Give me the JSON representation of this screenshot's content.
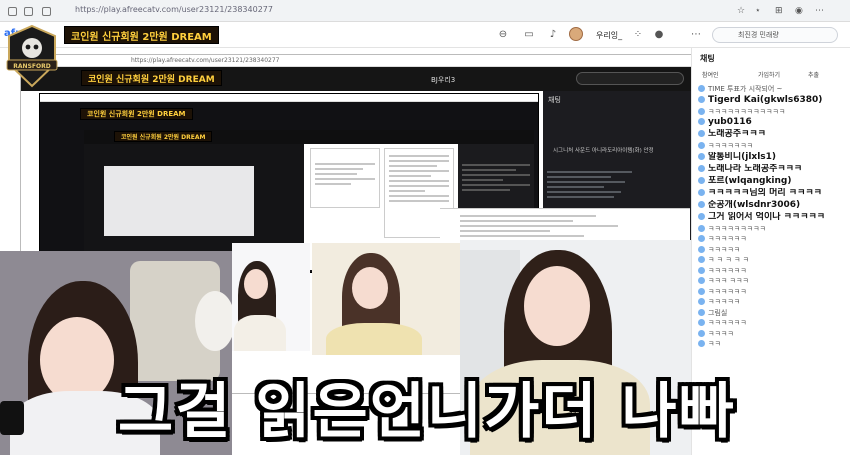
{
  "browser": {
    "url": "https://play.afreecatv.com/user23121/238340277",
    "inner_url": "https://play.afreecatv.com/user23121/238340277"
  },
  "app": {
    "logo": "afreeca",
    "banner_title": "코인원 신규회원 2만원 DREAM",
    "user_name": "우리잉_",
    "search_placeholder": "최진경 민래량",
    "nested_user_name": "BJ우리3"
  },
  "badge": {
    "text": "RANSFORD"
  },
  "inner_chat": {
    "title": "채팅",
    "notice": "시그니처 사운드 아니라도리아이템(화) 안정"
  },
  "chat": {
    "title": "채팅",
    "tabs": [
      "참여인",
      "가입하기",
      "추출"
    ],
    "messages": [
      {
        "name": "",
        "text": "TIME 투표가 시작되어 ~",
        "big": false
      },
      {
        "name": "",
        "text": "Tigerd Kai(gkwls6380)",
        "big": true
      },
      {
        "name": "",
        "text": "ㅋㅋㅋㅋㅋㅋㅋㅋㅋㅋㅋㅋ",
        "big": false
      },
      {
        "name": "",
        "text": "yub0116",
        "big": true
      },
      {
        "name": "",
        "text": "노래공주ㅋㅋㅋ",
        "big": true
      },
      {
        "name": "",
        "text": "ㅋㅋㅋㅋㅋㅋㅋ",
        "big": false
      },
      {
        "name": "",
        "text": "알통비니(jlxls1)",
        "big": true
      },
      {
        "name": "",
        "text": "노래나라 노래공주ㅋㅋㅋ",
        "big": true
      },
      {
        "name": "",
        "text": "포르(wlqangking)",
        "big": true
      },
      {
        "name": "",
        "text": "ㅋㅋㅋㅋㅋ님의 머리 ㅋㅋㅋㅋ",
        "big": true
      },
      {
        "name": "",
        "text": "순공개(wlsdnr3006)",
        "big": true
      },
      {
        "name": "",
        "text": "그거 읽어서 억이나 ㅋㅋㅋㅋㅋ",
        "big": true
      },
      {
        "name": "",
        "text": "ㅋㅋㅋㅋㅋㅋㅋㅋㅋ",
        "big": false
      },
      {
        "name": "",
        "text": "ㅋㅋㅋㅋㅋㅋ",
        "big": false
      },
      {
        "name": "",
        "text": "ㅋㅋㅋㅋㅋ",
        "big": false
      },
      {
        "name": "",
        "text": "ㅋ ㅋ ㅋ ㅋ ㅋ",
        "big": false
      },
      {
        "name": "",
        "text": "ㅋㅋㅋㅋㅋㅋ",
        "big": false
      },
      {
        "name": "",
        "text": "ㅋㅋㅋ ㅋㅋㅋ",
        "big": false
      },
      {
        "name": "",
        "text": "ㅋㅋㅋㅋㅋㅋ",
        "big": false
      },
      {
        "name": "",
        "text": "ㅋㅋㅋㅋㅋ",
        "big": false
      },
      {
        "name": "",
        "text": "그림실",
        "big": false
      },
      {
        "name": "",
        "text": "ㅋㅋㅋㅋㅋㅋ",
        "big": false
      },
      {
        "name": "",
        "text": "ㅋㅋㅋㅋ",
        "big": false
      },
      {
        "name": "",
        "text": "ㅋㅋ",
        "big": false
      }
    ]
  },
  "subtitle": "그걸 읽은언니가더 나빠"
}
